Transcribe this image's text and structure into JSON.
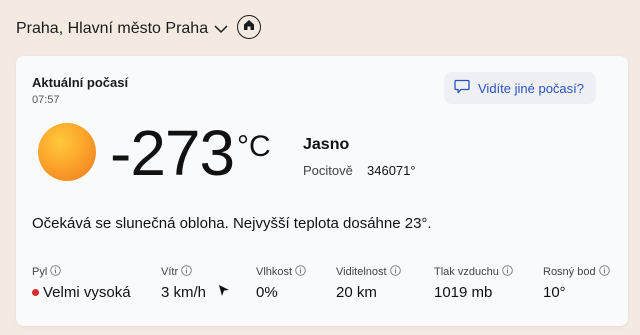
{
  "location": {
    "name": "Praha, Hlavní město Praha"
  },
  "icons": {
    "dropdown": "chevron-down-icon",
    "home": "home-icon",
    "feedback": "chat-icon",
    "weather": "sun-icon",
    "info": "info-icon",
    "wind_direction": "arrow-icon"
  },
  "current": {
    "title": "Aktuální počasí",
    "time": "07:57",
    "other_weather_button": "Vidíte jiné počasí?",
    "temperature": "-273",
    "unit": "°C",
    "condition": "Jasno",
    "feels_label": "Pocitově",
    "feels_value": "346071°",
    "summary": "Očekává se slunečná obloha. Nejvyšší teplota dosáhne 23°."
  },
  "metrics": [
    {
      "label": "Pyl",
      "value": "Velmi vysoká",
      "status_color": "#d32f2f"
    },
    {
      "label": "Vítr",
      "value": "3 km/h"
    },
    {
      "label": "Vlhkost",
      "value": "0%"
    },
    {
      "label": "Viditelnost",
      "value": "20 km"
    },
    {
      "label": "Tlak vzduchu",
      "value": "1019 mb"
    },
    {
      "label": "Rosný bod",
      "value": "10°"
    }
  ],
  "colors": {
    "accent": "#2a52be",
    "background": "#f3ebe1",
    "card": "#f9fafc"
  }
}
